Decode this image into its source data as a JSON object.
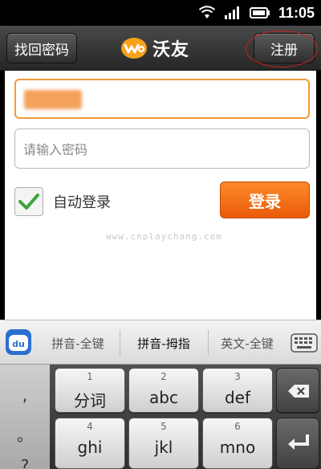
{
  "status_bar": {
    "time": "11:05",
    "icons": [
      "wifi-icon",
      "signal-icon",
      "battery-icon"
    ]
  },
  "title_bar": {
    "left_button": "找回密码",
    "brand_name": "沃友",
    "right_button": "注册"
  },
  "login": {
    "username_value": "",
    "password_placeholder": "请输入密码",
    "auto_login_label": "自动登录",
    "auto_login_checked": true,
    "login_button": "登录",
    "watermark": "www.cnplaychang.com"
  },
  "candidate_bar": {
    "items": [
      "拼音-全键",
      "拼音-拇指",
      "英文-全键"
    ],
    "active_index": 1
  },
  "keyboard": {
    "punct": [
      ",",
      "。",
      "?"
    ],
    "keys": [
      {
        "num": "1",
        "label": "分词"
      },
      {
        "num": "2",
        "label": "abc"
      },
      {
        "num": "3",
        "label": "def"
      },
      {
        "num": "4",
        "label": "ghi"
      },
      {
        "num": "5",
        "label": "jkl"
      },
      {
        "num": "6",
        "label": "mno"
      }
    ]
  },
  "colors": {
    "accent_orange": "#f07820",
    "title_bar": "#333333",
    "mark_red": "#d02020"
  }
}
